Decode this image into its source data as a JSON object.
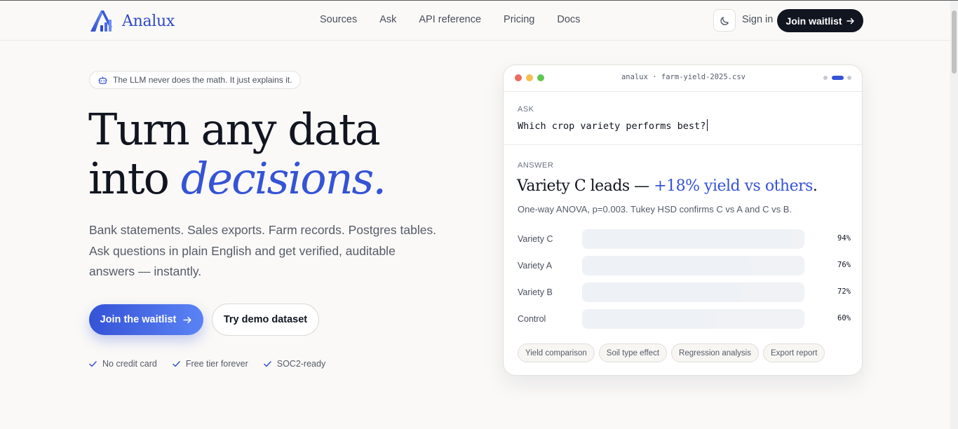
{
  "header": {
    "brand": "Analux",
    "nav": [
      "Sources",
      "Ask",
      "API reference",
      "Pricing",
      "Docs"
    ],
    "sign_in": "Sign in",
    "join_label": "Join waitlist"
  },
  "hero": {
    "pill_text": "The LLM never does the math. It just explains it.",
    "title_line1": "Turn any data",
    "title_line2_plain": "into ",
    "title_line2_em": "decisions",
    "title_period": ".",
    "subtitle": "Bank statements. Sales exports. Farm records. Postgres tables. Ask questions in plain English and get verified, auditable answers — instantly.",
    "cta_primary": "Join the waitlist",
    "cta_secondary": "Try demo dataset",
    "checks": [
      "No credit card",
      "Free tier forever",
      "SOC2-ready"
    ]
  },
  "demo": {
    "filename": "analux · farm-yield-2025.csv",
    "ask_label": "ASK",
    "question": "Which crop variety performs best?",
    "answer_label": "ANSWER",
    "answer_head": "Variety C leads — ",
    "answer_highlight": "+18% yield vs others",
    "answer_period": ".",
    "answer_note": "One-way ANOVA, p=0.003. Tukey HSD confirms C vs A and C vs B.",
    "bars": [
      {
        "label": "Variety C",
        "pct": "94%",
        "value": 0.94
      },
      {
        "label": "Variety A",
        "pct": "76%",
        "value": 0.76
      },
      {
        "label": "Variety B",
        "pct": "72%",
        "value": 0.72
      },
      {
        "label": "Control",
        "pct": "60%",
        "value": 0.6
      }
    ],
    "chips": [
      "Yield comparison",
      "Soil type effect",
      "Regression analysis",
      "Export report"
    ]
  },
  "colors": {
    "accent": "#3553d6",
    "dark": "#111520",
    "dot_red": "#ec6a5f",
    "dot_yellow": "#f4bf4f",
    "dot_green": "#61c554"
  }
}
